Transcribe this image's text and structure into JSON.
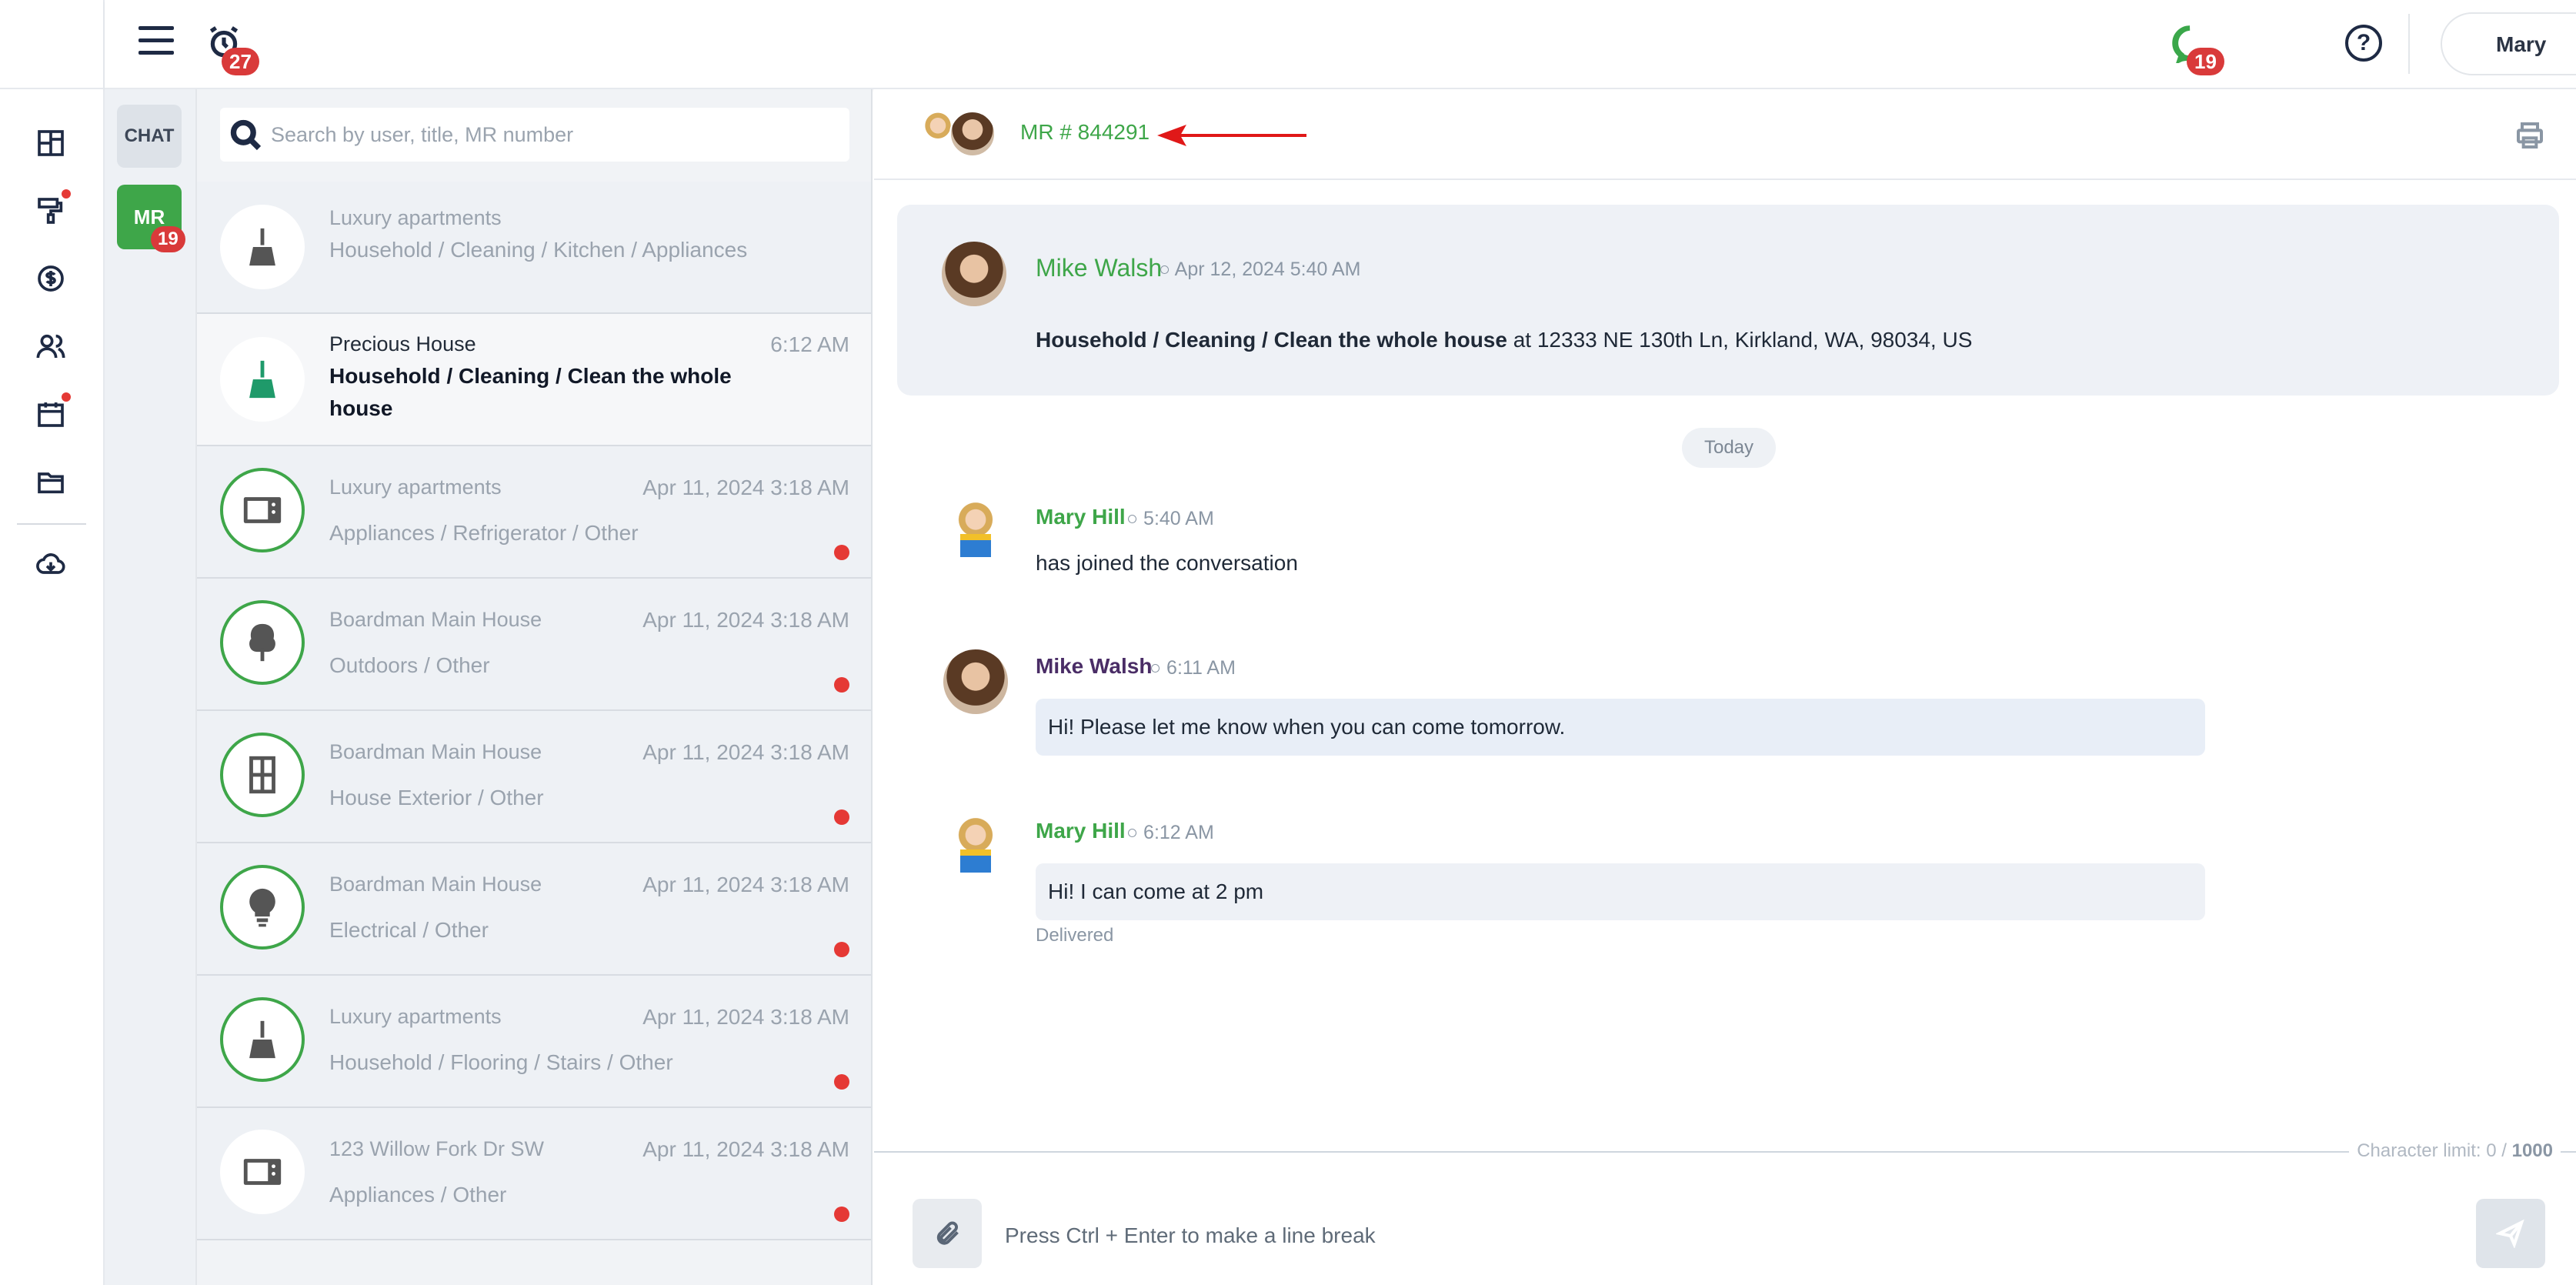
{
  "header": {
    "notifications_count": "27",
    "messages_count": "19",
    "help_label": "?",
    "user_name": "Mary"
  },
  "categories": {
    "chat_label": "CHAT",
    "mr_label": "MR",
    "mr_count": "19"
  },
  "search": {
    "placeholder": "Search by user, title, MR number"
  },
  "conversations": [
    {
      "title": "Luxury apartments",
      "subtitle": "Household / Cleaning / Kitchen / Appliances",
      "time": "",
      "icon": "broom-icon",
      "unread": false,
      "active": false
    },
    {
      "title": "Precious House",
      "subtitle": "Household / Cleaning / Clean the whole house",
      "time": "6:12 AM",
      "icon": "broom-icon",
      "unread": false,
      "active": true
    },
    {
      "title": "Luxury apartments",
      "subtitle": "Appliances / Refrigerator / Other",
      "time": "Apr 11, 2024 3:18 AM",
      "icon": "microwave-icon",
      "unread": true,
      "active": false
    },
    {
      "title": "Boardman Main House",
      "subtitle": "Outdoors / Other",
      "time": "Apr 11, 2024 3:18 AM",
      "icon": "tree-icon",
      "unread": true,
      "active": false
    },
    {
      "title": "Boardman Main House",
      "subtitle": "House Exterior / Other",
      "time": "Apr 11, 2024 3:18 AM",
      "icon": "window-icon",
      "unread": true,
      "active": false
    },
    {
      "title": "Boardman Main House",
      "subtitle": "Electrical / Other",
      "time": "Apr 11, 2024 3:18 AM",
      "icon": "lightbulb-icon",
      "unread": true,
      "active": false
    },
    {
      "title": "Luxury apartments",
      "subtitle": "Household / Flooring / Stairs / Other",
      "time": "Apr 11, 2024 3:18 AM",
      "icon": "broom-icon",
      "unread": true,
      "active": false
    },
    {
      "title": "123 Willow Fork Dr SW",
      "subtitle": "Appliances / Other",
      "time": "Apr 11, 2024 3:18 AM",
      "icon": "microwave-icon",
      "unread": true,
      "active": false
    }
  ],
  "chat": {
    "mr_number": "MR # 844291",
    "request": {
      "author": "Mike Walsh",
      "time": "○ Apr 12, 2024 5:40 AM",
      "category": "Household / Cleaning / Clean the whole house",
      "address": " at 12333 NE 130th Ln, Kirkland, WA, 98034, US"
    },
    "day_divider": "Today",
    "messages": [
      {
        "author": "Mary Hill",
        "time": "○ 5:40 AM",
        "text": "has joined the conversation"
      },
      {
        "author": "Mike Walsh",
        "time": "○ 6:11 AM",
        "text": "Hi! Please let me know when you can come tomorrow."
      },
      {
        "author": "Mary Hill",
        "time": "○ 6:12 AM",
        "text": "Hi! I can come at 2 pm",
        "status": "Delivered"
      }
    ],
    "char_limit_prefix": "Character limit: 0 / ",
    "char_limit_max": "1000",
    "compose_placeholder": "Press Ctrl + Enter to make a line break"
  },
  "colors": {
    "accent_green": "#3ea649",
    "badge_red": "#d93a3a",
    "navy": "#1e2a44"
  }
}
